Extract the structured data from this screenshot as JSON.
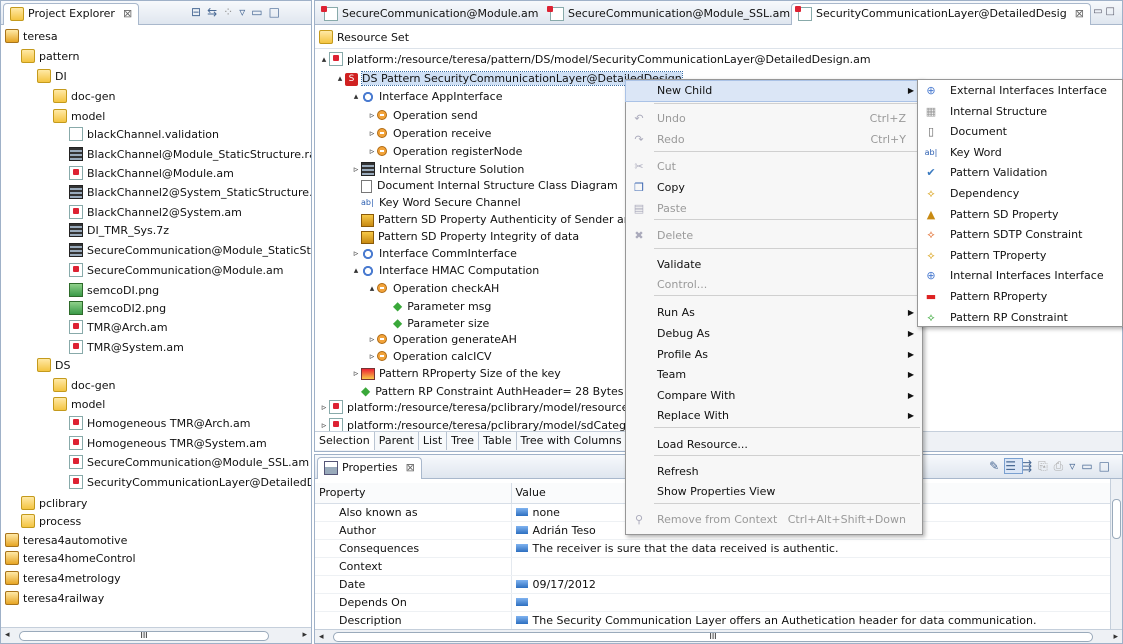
{
  "project_explorer": {
    "tab_label": "Project Explorer",
    "tree": [
      {
        "label": "teresa",
        "icon": "project-icon",
        "expanded": true
      },
      {
        "label": "pattern",
        "icon": "folder-icon"
      },
      {
        "label": "DI",
        "icon": "folder-icon"
      },
      {
        "label": "doc-gen",
        "icon": "folder-icon"
      },
      {
        "label": "model",
        "icon": "folder-icon"
      },
      {
        "label": "blackChannel.validation",
        "icon": "file-icon"
      },
      {
        "label": "BlackChannel@Module_StaticStructure.ra",
        "icon": "model-icon"
      },
      {
        "label": "BlackChannel@Module.am",
        "icon": "am-file-icon"
      },
      {
        "label": "BlackChannel2@System_StaticStructure.r",
        "icon": "model-icon"
      },
      {
        "label": "BlackChannel2@System.am",
        "icon": "am-file-icon"
      },
      {
        "label": "DI_TMR_Sys.7z",
        "icon": "model-icon"
      },
      {
        "label": "SecureCommunication@Module_StaticSt",
        "icon": "model-icon"
      },
      {
        "label": "SecureCommunication@Module.am",
        "icon": "am-file-icon"
      },
      {
        "label": "semcoDI.png",
        "icon": "image-icon"
      },
      {
        "label": "semcoDI2.png",
        "icon": "image-icon"
      },
      {
        "label": "TMR@Arch.am",
        "icon": "am-file-icon"
      },
      {
        "label": "TMR@System.am",
        "icon": "am-file-icon"
      },
      {
        "label": "DS",
        "icon": "folder-icon"
      },
      {
        "label": "doc-gen",
        "icon": "folder-icon"
      },
      {
        "label": "model",
        "icon": "folder-icon"
      },
      {
        "label": "Homogeneous TMR@Arch.am",
        "icon": "am-file-icon"
      },
      {
        "label": "Homogeneous TMR@System.am",
        "icon": "am-file-icon"
      },
      {
        "label": "SecureCommunication@Module_SSL.am",
        "icon": "am-file-icon"
      },
      {
        "label": "SecurityCommunicationLayer@DetailedD",
        "icon": "am-file-icon"
      },
      {
        "label": "pclibrary",
        "icon": "folder-icon"
      },
      {
        "label": "process",
        "icon": "folder-icon"
      },
      {
        "label": "teresa4automotive",
        "icon": "project-icon"
      },
      {
        "label": "teresa4homeControl",
        "icon": "project-icon"
      },
      {
        "label": "teresa4metrology",
        "icon": "project-icon"
      },
      {
        "label": "teresa4railway",
        "icon": "project-icon"
      }
    ],
    "scroll_mid": "III"
  },
  "editor": {
    "tabs": [
      {
        "label": "SecureCommunication@Module.am"
      },
      {
        "label": "SecureCommunication@Module_SSL.am"
      },
      {
        "label": "SecurityCommunicationLayer@DetailedDesig"
      }
    ],
    "header": "Resource Set",
    "tree": [
      {
        "label": "platform:/resource/teresa/pattern/DS/model/SecurityCommunicationLayer@DetailedDesign.am"
      },
      {
        "label": "DS Pattern SecurityCommunicationLayer@DetailedDesign"
      },
      {
        "label": "Interface AppInterface"
      },
      {
        "label": "Operation send"
      },
      {
        "label": "Operation receive"
      },
      {
        "label": "Operation registerNode"
      },
      {
        "label": "Internal Structure Solution"
      },
      {
        "label": "Document Internal Structure Class Diagram"
      },
      {
        "label": "Key Word Secure Channel"
      },
      {
        "label": "Pattern SD Property Authenticity of Sender and"
      },
      {
        "label": "Pattern SD Property Integrity of data"
      },
      {
        "label": "Interface CommInterface"
      },
      {
        "label": "Interface HMAC Computation"
      },
      {
        "label": "Operation checkAH"
      },
      {
        "label": "Parameter msg"
      },
      {
        "label": "Parameter size"
      },
      {
        "label": "Operation generateAH"
      },
      {
        "label": "Operation calcICV"
      },
      {
        "label": "Pattern RProperty Size of the key"
      },
      {
        "label": "Pattern RP Constraint AuthHeader= 28 Bytes"
      },
      {
        "label": "platform:/resource/teresa/pclibrary/model/resourceCa"
      },
      {
        "label": "platform:/resource/teresa/pclibrary/model/sdCategory"
      }
    ],
    "bottom_tabs": [
      "Selection",
      "Parent",
      "List",
      "Tree",
      "Table",
      "Tree with Columns"
    ],
    "scroll_mid": "III"
  },
  "properties": {
    "tab_label": "Properties",
    "columns": [
      "Property",
      "Value"
    ],
    "rows": [
      {
        "property": "Also known as",
        "value": "none"
      },
      {
        "property": "Author",
        "value": "Adrián Teso"
      },
      {
        "property": "Consequences",
        "value": "The receiver is sure that the data received is authentic."
      },
      {
        "property": "Context",
        "value": ""
      },
      {
        "property": "Date",
        "value": "09/17/2012"
      },
      {
        "property": "Depends On",
        "value": ""
      },
      {
        "property": "Description",
        "value": "The Security Communication Layer offers an Authetication header for data communication."
      }
    ]
  },
  "context_menu": {
    "items": [
      {
        "label": "New Child",
        "accel": "",
        "submenu": true,
        "disabled": false,
        "icon": ""
      },
      {
        "label": "Undo",
        "accel": "Ctrl+Z",
        "submenu": false,
        "disabled": true,
        "icon": "undo-icon"
      },
      {
        "label": "Redo",
        "accel": "Ctrl+Y",
        "submenu": false,
        "disabled": true,
        "icon": "redo-icon"
      },
      {
        "label": "Cut",
        "accel": "",
        "submenu": false,
        "disabled": true,
        "icon": "cut-icon"
      },
      {
        "label": "Copy",
        "accel": "",
        "submenu": false,
        "disabled": false,
        "icon": "copy-icon"
      },
      {
        "label": "Paste",
        "accel": "",
        "submenu": false,
        "disabled": true,
        "icon": "paste-icon"
      },
      {
        "label": "Delete",
        "accel": "",
        "submenu": false,
        "disabled": true,
        "icon": "delete-icon"
      },
      {
        "label": "Validate",
        "accel": "",
        "submenu": false,
        "disabled": false,
        "icon": ""
      },
      {
        "label": "Control...",
        "accel": "",
        "submenu": false,
        "disabled": true,
        "icon": ""
      },
      {
        "label": "Run As",
        "accel": "",
        "submenu": true,
        "disabled": false,
        "icon": ""
      },
      {
        "label": "Debug As",
        "accel": "",
        "submenu": true,
        "disabled": false,
        "icon": ""
      },
      {
        "label": "Profile As",
        "accel": "",
        "submenu": true,
        "disabled": false,
        "icon": ""
      },
      {
        "label": "Team",
        "accel": "",
        "submenu": true,
        "disabled": false,
        "icon": ""
      },
      {
        "label": "Compare With",
        "accel": "",
        "submenu": true,
        "disabled": false,
        "icon": ""
      },
      {
        "label": "Replace With",
        "accel": "",
        "submenu": true,
        "disabled": false,
        "icon": ""
      },
      {
        "label": "Load Resource...",
        "accel": "",
        "submenu": false,
        "disabled": false,
        "icon": ""
      },
      {
        "label": "Refresh",
        "accel": "",
        "submenu": false,
        "disabled": false,
        "icon": ""
      },
      {
        "label": "Show Properties View",
        "accel": "",
        "submenu": false,
        "disabled": false,
        "icon": ""
      },
      {
        "label": "Remove from Context",
        "accel": "Ctrl+Alt+Shift+Down",
        "submenu": false,
        "disabled": true,
        "icon": "remove-context-icon"
      }
    ]
  },
  "submenu": {
    "items": [
      "External Interfaces Interface",
      "Internal Structure",
      "Document",
      "Key Word",
      "Pattern Validation",
      "Dependency",
      "Pattern SD Property",
      "Pattern SDTP Constraint",
      "Pattern TProperty",
      "Internal Interfaces Interface",
      "Pattern RProperty",
      "Pattern RP Constraint"
    ]
  }
}
